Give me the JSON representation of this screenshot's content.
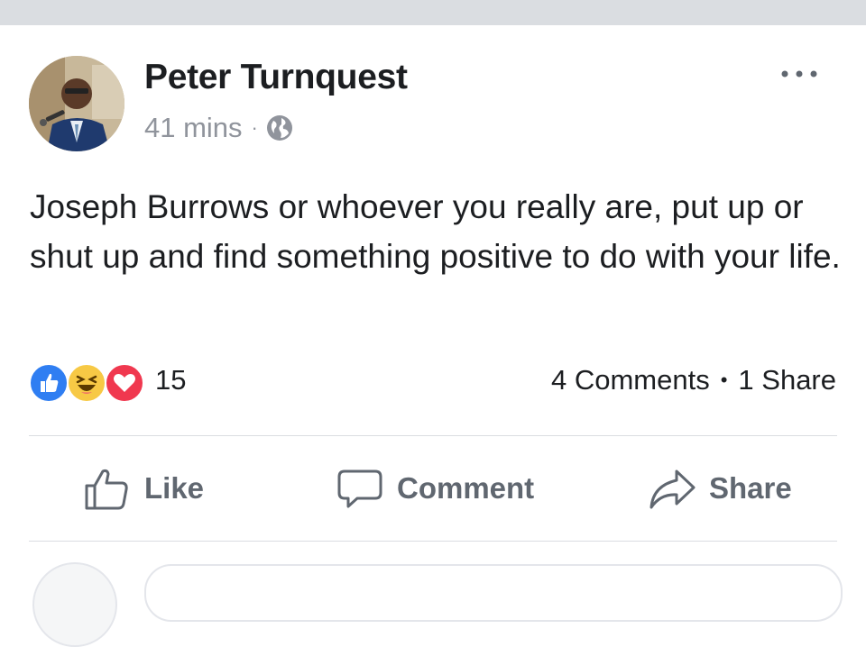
{
  "post": {
    "author": "Peter Turnquest",
    "time": "41 mins",
    "separator": "·",
    "privacy_icon": "globe-icon",
    "text": "Joseph Burrows or whoever you really are, put up or shut up and find something positive to do with your life.",
    "reactions": {
      "icons": [
        "like-reaction-icon",
        "haha-reaction-icon",
        "love-reaction-icon"
      ],
      "count": "15"
    },
    "comments": "4 Comments",
    "stats_separator": "•",
    "shares": "1 Share"
  },
  "actions": {
    "like": "Like",
    "comment": "Comment",
    "share": "Share"
  },
  "colors": {
    "like_blue": "#2f7ef2",
    "haha_yellow": "#f7c945",
    "love_red": "#f0384f",
    "meta_gray": "#90949c",
    "action_gray": "#606770"
  }
}
